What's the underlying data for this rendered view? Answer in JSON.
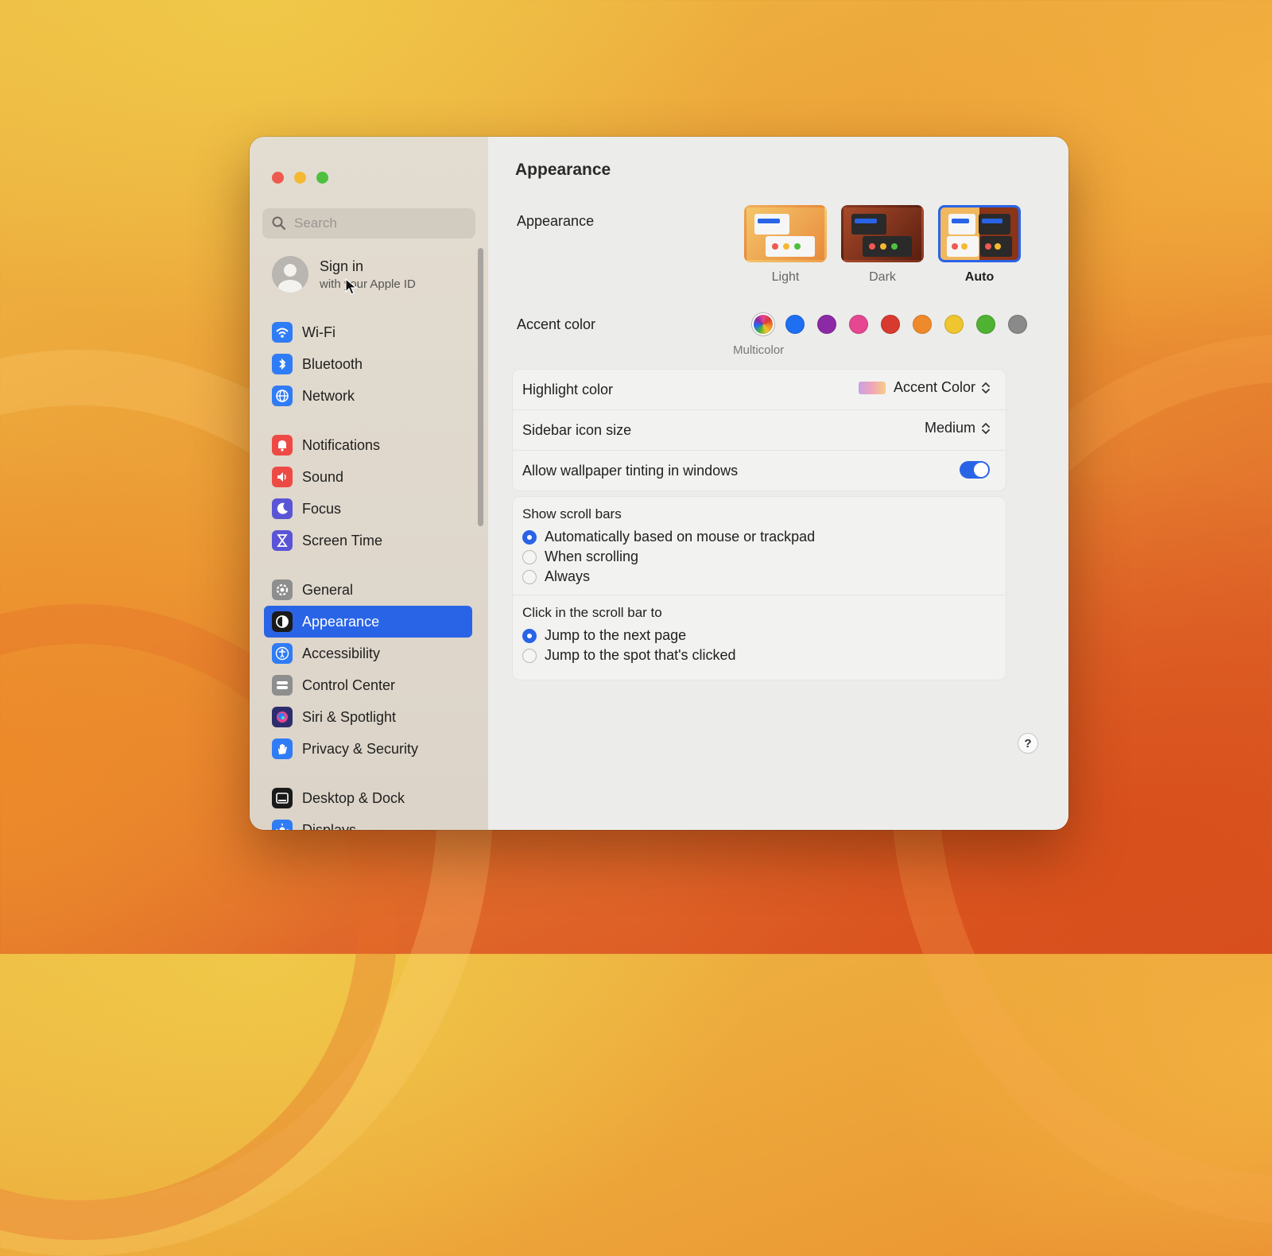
{
  "window": {
    "title": "Appearance"
  },
  "sidebar": {
    "search_placeholder": "Search",
    "account": {
      "title": "Sign in",
      "subtitle": "with your Apple ID"
    },
    "groups": [
      [
        {
          "label": "Wi-Fi",
          "icon": "wifi-icon",
          "color": "#2f7cf6"
        },
        {
          "label": "Bluetooth",
          "icon": "bluetooth-icon",
          "color": "#2f7cf6"
        },
        {
          "label": "Network",
          "icon": "globe-icon",
          "color": "#2f7cf6"
        }
      ],
      [
        {
          "label": "Notifications",
          "icon": "bell-icon",
          "color": "#ee4a45"
        },
        {
          "label": "Sound",
          "icon": "speaker-icon",
          "color": "#ee4a45"
        },
        {
          "label": "Focus",
          "icon": "moon-icon",
          "color": "#5a55d6"
        },
        {
          "label": "Screen Time",
          "icon": "hourglass-icon",
          "color": "#5a55d6"
        }
      ],
      [
        {
          "label": "General",
          "icon": "gear-icon",
          "color": "#8e8e8e"
        },
        {
          "label": "Appearance",
          "icon": "appearance-icon",
          "color": "#1a1a1a",
          "active": true
        },
        {
          "label": "Accessibility",
          "icon": "accessibility-icon",
          "color": "#2f7cf6"
        },
        {
          "label": "Control Center",
          "icon": "control-center-icon",
          "color": "#8e8e8e"
        },
        {
          "label": "Siri & Spotlight",
          "icon": "siri-icon",
          "color": "#2d2d6e"
        },
        {
          "label": "Privacy & Security",
          "icon": "hand-icon",
          "color": "#2f7cf6"
        }
      ],
      [
        {
          "label": "Desktop & Dock",
          "icon": "dock-icon",
          "color": "#1a1a1a"
        },
        {
          "label": "Displays",
          "icon": "sun-icon",
          "color": "#2f7cf6"
        }
      ]
    ]
  },
  "content": {
    "title": "Appearance",
    "appearance": {
      "label": "Appearance",
      "options": [
        {
          "label": "Light"
        },
        {
          "label": "Dark"
        },
        {
          "label": "Auto",
          "selected": true
        }
      ]
    },
    "accent": {
      "label": "Accent color",
      "caption": "Multicolor",
      "colors": [
        "multicolor",
        "#1f6ff2",
        "#8c2aa6",
        "#e54790",
        "#d93a30",
        "#ef8a2a",
        "#efc530",
        "#4fb233",
        "#8a8a8a"
      ]
    },
    "rows": {
      "highlight": {
        "label": "Highlight color",
        "value": "Accent Color"
      },
      "sidebar_icon_size": {
        "label": "Sidebar icon size",
        "value": "Medium"
      },
      "wallpaper_tinting": {
        "label": "Allow wallpaper tinting in windows",
        "enabled": true
      }
    },
    "scroll_bars": {
      "title": "Show scroll bars",
      "options": [
        "Automatically based on mouse or trackpad",
        "When scrolling",
        "Always"
      ],
      "selected": 0
    },
    "click_scroll": {
      "title": "Click in the scroll bar to",
      "options": [
        "Jump to the next page",
        "Jump to the spot that's clicked"
      ],
      "selected": 0
    },
    "help": "?"
  },
  "colors": {
    "accent": "#2a64e6"
  }
}
